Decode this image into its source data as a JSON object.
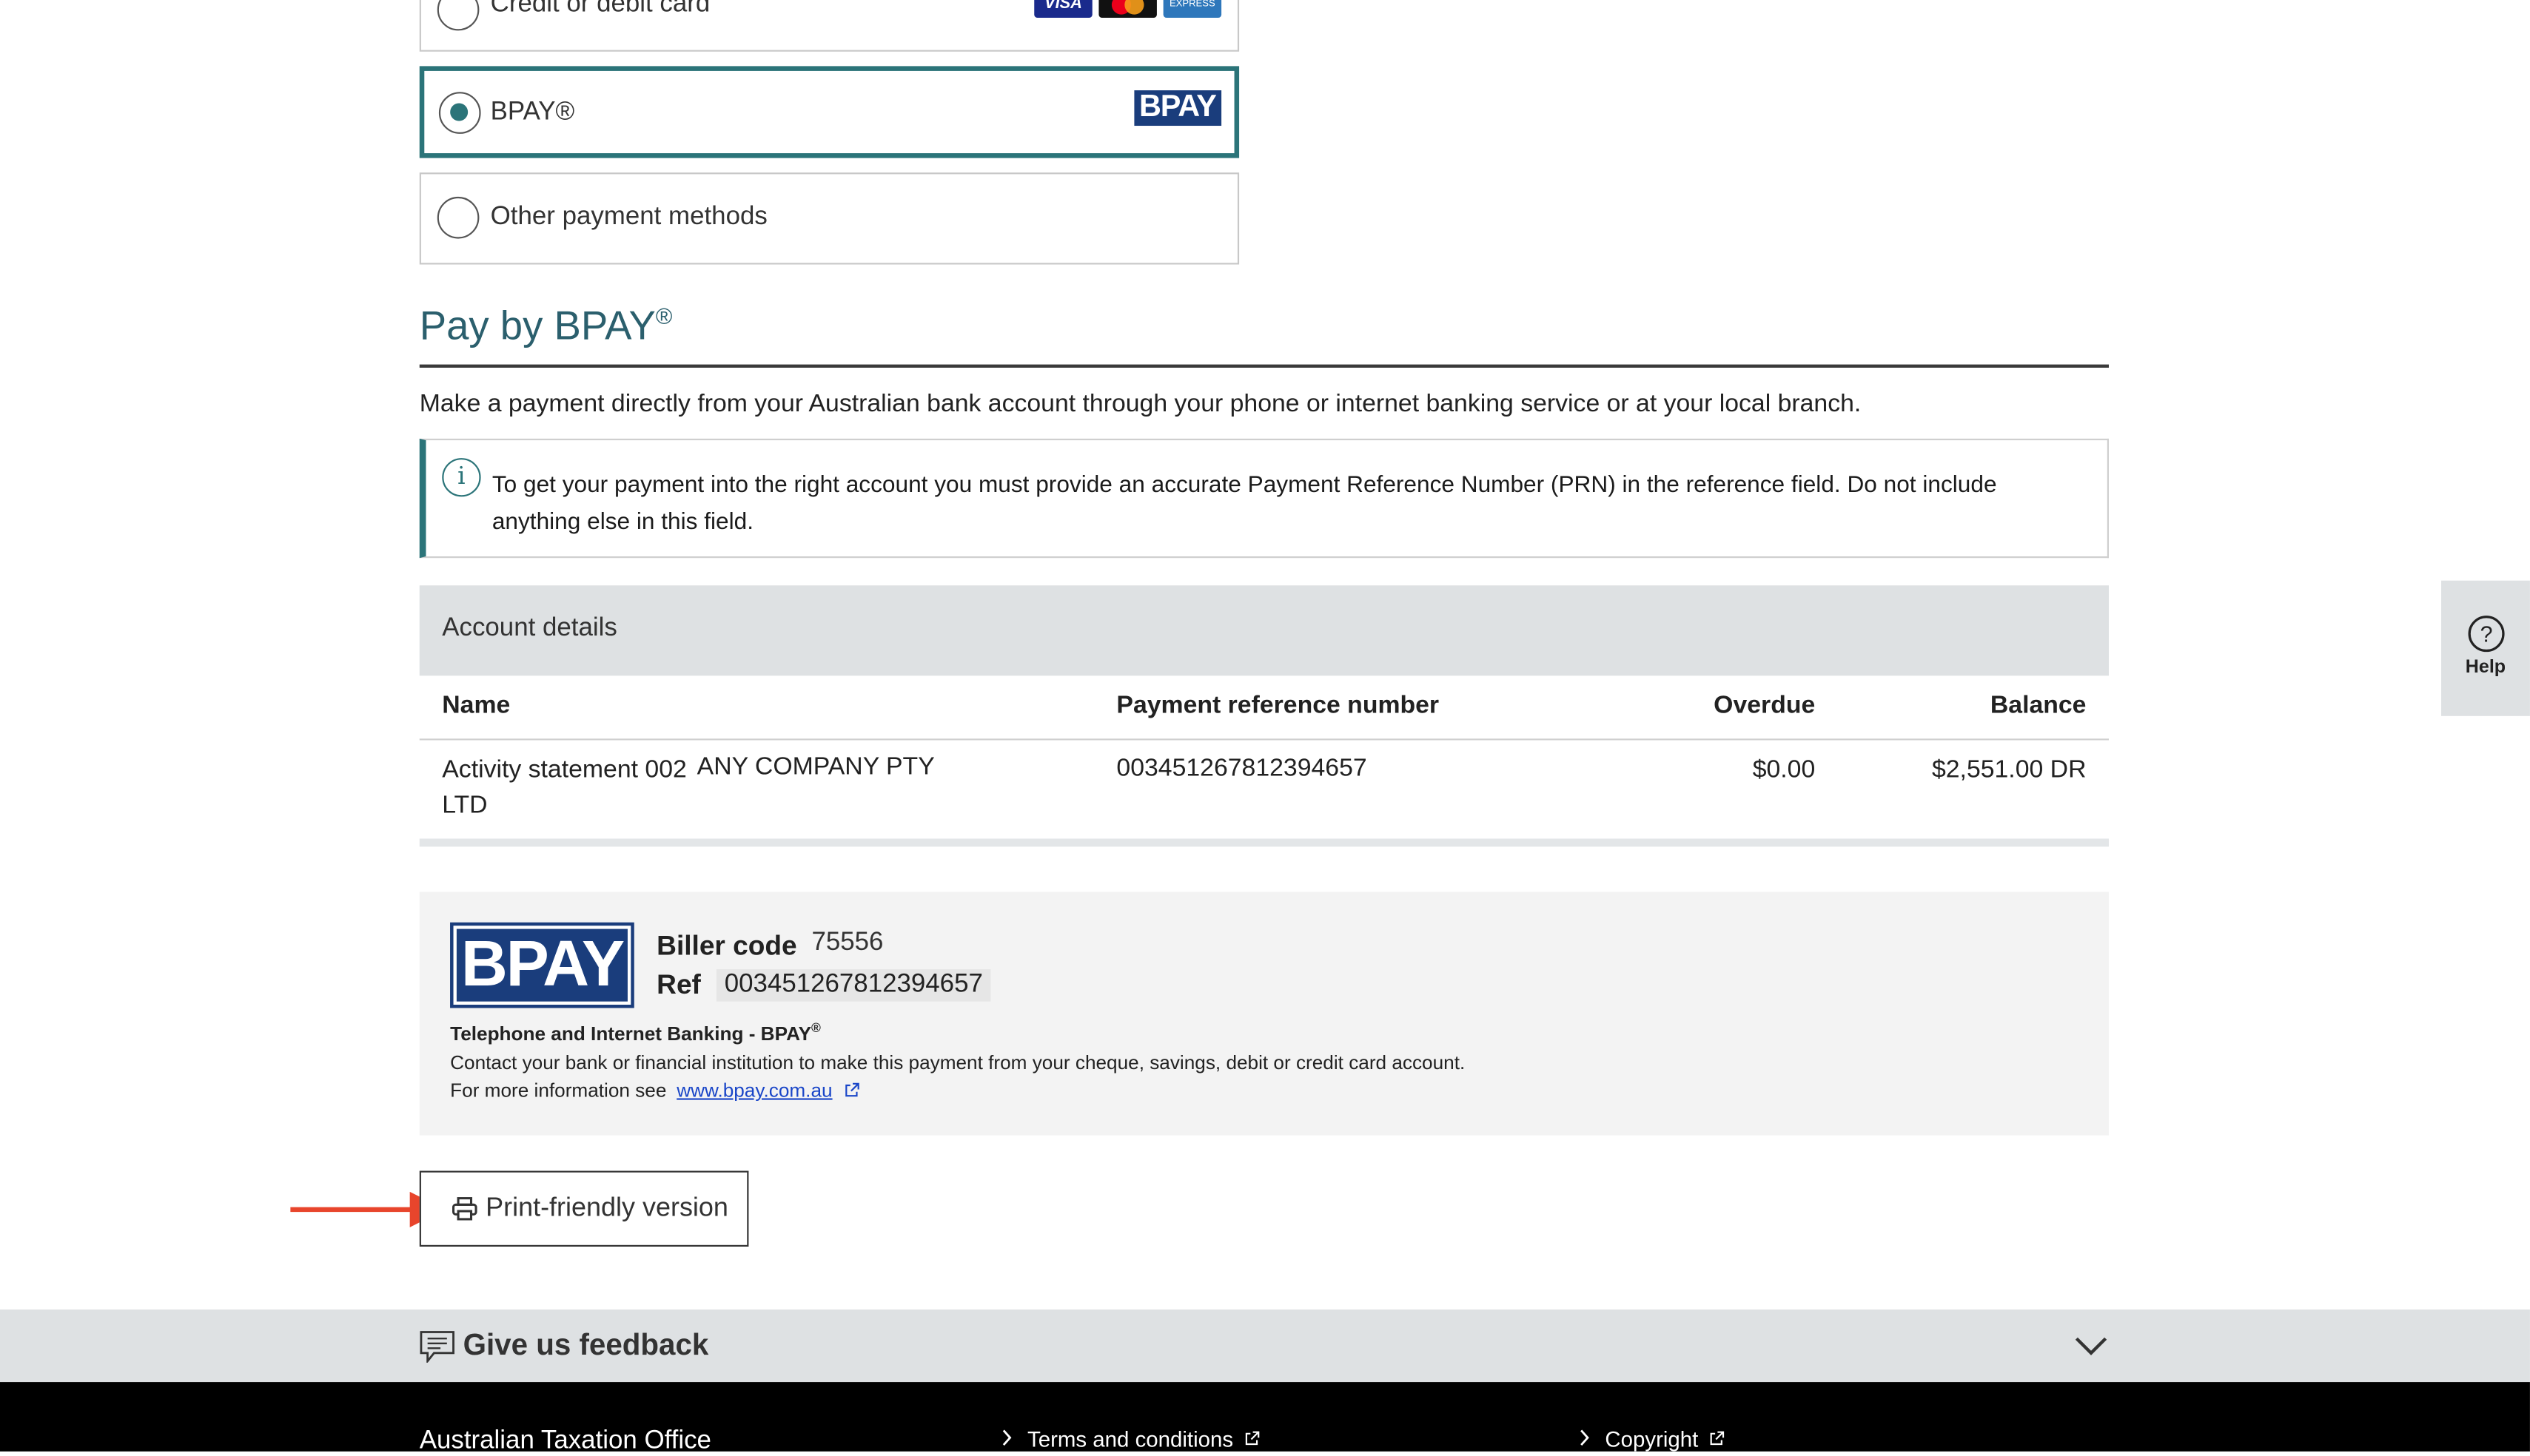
{
  "payment_options": {
    "card": {
      "label": "Credit or debit card",
      "logos": [
        "VISA",
        "mastercard",
        "EXPRESS"
      ]
    },
    "bpay": {
      "label": "BPAY®",
      "logo": "BPAY",
      "selected": true
    },
    "other": {
      "label": "Other payment methods"
    }
  },
  "section": {
    "title": "Pay by BPAY",
    "title_sup": "®",
    "description": "Make a payment directly from your Australian bank account through your phone or internet banking service or at your local branch."
  },
  "info_box": {
    "icon": "info-icon",
    "text": "To get your payment into the right account you must provide an accurate Payment Reference Number (PRN) in the reference field. Do not include anything else in this field."
  },
  "account_details": {
    "heading": "Account details",
    "columns": [
      "Name",
      "Payment reference number",
      "Overdue",
      "Balance"
    ],
    "rows": [
      {
        "name_line1": "Activity statement 002",
        "company": "ANY COMPANY PTY",
        "name_line2": "LTD",
        "prn": "003451267812394657",
        "overdue": "$0.00",
        "balance": "$2,551.00 DR"
      }
    ]
  },
  "bpay_box": {
    "logo": "BPAY",
    "biller_code_label": "Biller code",
    "biller_code": "75556",
    "ref_label": "Ref",
    "ref": "003451267812394657",
    "heading": "Telephone and Internet Banking - BPAY",
    "heading_sup": "®",
    "contact_text": "Contact your bank or financial institution to make this payment from your cheque, savings, debit or credit card account.",
    "more_info_prefix": "For more information see",
    "link": "www.bpay.com.au"
  },
  "print_button": {
    "label": "Print-friendly version",
    "icon": "printer-icon"
  },
  "feedback": {
    "label": "Give us feedback",
    "icon": "comment-icon"
  },
  "footer": {
    "org": "Australian Taxation Office",
    "links": [
      "Terms and conditions",
      "Copyright"
    ]
  },
  "help": {
    "label": "Help",
    "icon": "question-icon"
  },
  "colors": {
    "teal": "#2b7479",
    "bpay_blue": "#1a3d7c",
    "arrow": "#e8452c",
    "panel_grey": "#dee1e3"
  }
}
